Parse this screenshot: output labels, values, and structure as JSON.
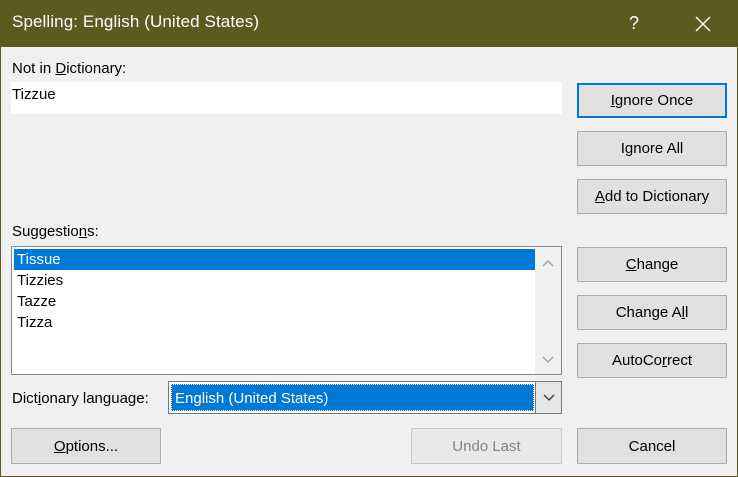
{
  "window": {
    "title": "Spelling: English (United States)",
    "help_label": "?"
  },
  "not_in_dictionary": {
    "label_pre": "Not in ",
    "label_accel": "D",
    "label_post": "ictionary:",
    "value": "Tizzue"
  },
  "suggestions": {
    "label_pre": "Suggestio",
    "label_accel": "n",
    "label_post": "s:",
    "items": [
      "Tissue",
      "Tizzies",
      "Tazze",
      "Tizza"
    ],
    "selected_index": 0
  },
  "dictionary_language": {
    "label_pre": "Dict",
    "label_accel": "i",
    "label_post": "onary language:",
    "value": "English (United States)"
  },
  "buttons": {
    "ignore_once": {
      "pre": "",
      "accel": "I",
      "post": "gnore Once"
    },
    "ignore_all": {
      "pre": "I",
      "accel": "g",
      "post": "nore All"
    },
    "add_to_dictionary": {
      "pre": "",
      "accel": "A",
      "post": "dd to Dictionary"
    },
    "change": {
      "pre": "",
      "accel": "C",
      "post": "hange"
    },
    "change_all": {
      "pre": "Change A",
      "accel": "l",
      "post": "l"
    },
    "autocorrect": {
      "pre": "AutoCo",
      "accel": "r",
      "post": "rect"
    },
    "options": {
      "pre": "",
      "accel": "O",
      "post": "ptions..."
    },
    "undo_last": {
      "pre": "Undo Last",
      "accel": "",
      "post": ""
    },
    "cancel": {
      "pre": "Cancel",
      "accel": "",
      "post": ""
    }
  },
  "colors": {
    "titlebar": "#5b5a1f",
    "selection": "#0078d7",
    "default_button_border": "#0078d7"
  },
  "icons": {
    "close": "close-icon",
    "scroll_up": "chevron-up-icon",
    "scroll_down": "chevron-down-icon",
    "dropdown": "chevron-down-icon"
  }
}
